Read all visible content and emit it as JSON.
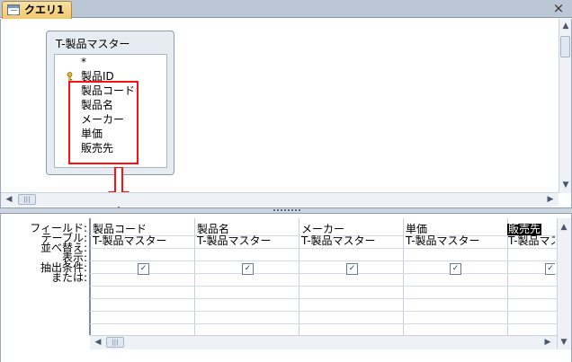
{
  "tab": {
    "title": "クエリ1",
    "close_glyph": "×"
  },
  "field_list": {
    "title": "T-製品マスター",
    "fields": [
      "*",
      "製品ID",
      "製品コード",
      "製品名",
      "メーカー",
      "単価",
      "販売先"
    ],
    "key_field": "製品ID"
  },
  "design_grid": {
    "row_labels": [
      "フィールド:",
      "テーブル:",
      "並べ替え:",
      "表示:",
      "抽出条件:",
      "または:"
    ],
    "columns": [
      {
        "field": "製品コード",
        "table": "T-製品マスター",
        "show": true
      },
      {
        "field": "製品名",
        "table": "T-製品マスター",
        "show": true
      },
      {
        "field": "メーカー",
        "table": "T-製品マスター",
        "show": true
      },
      {
        "field": "単価",
        "table": "T-製品マスター",
        "show": true
      },
      {
        "field": "販売先",
        "table": "T-製品マスタ",
        "show": true,
        "highlighted": true
      }
    ]
  },
  "annotation": {
    "color": "#ff1010"
  },
  "icons": {
    "scroll_left": "◀",
    "scroll_right": "▶",
    "scroll_up": "▲",
    "scroll_down": "▼",
    "grip": "|||",
    "check": "✓",
    "key": "key-icon",
    "query": "query-icon"
  }
}
